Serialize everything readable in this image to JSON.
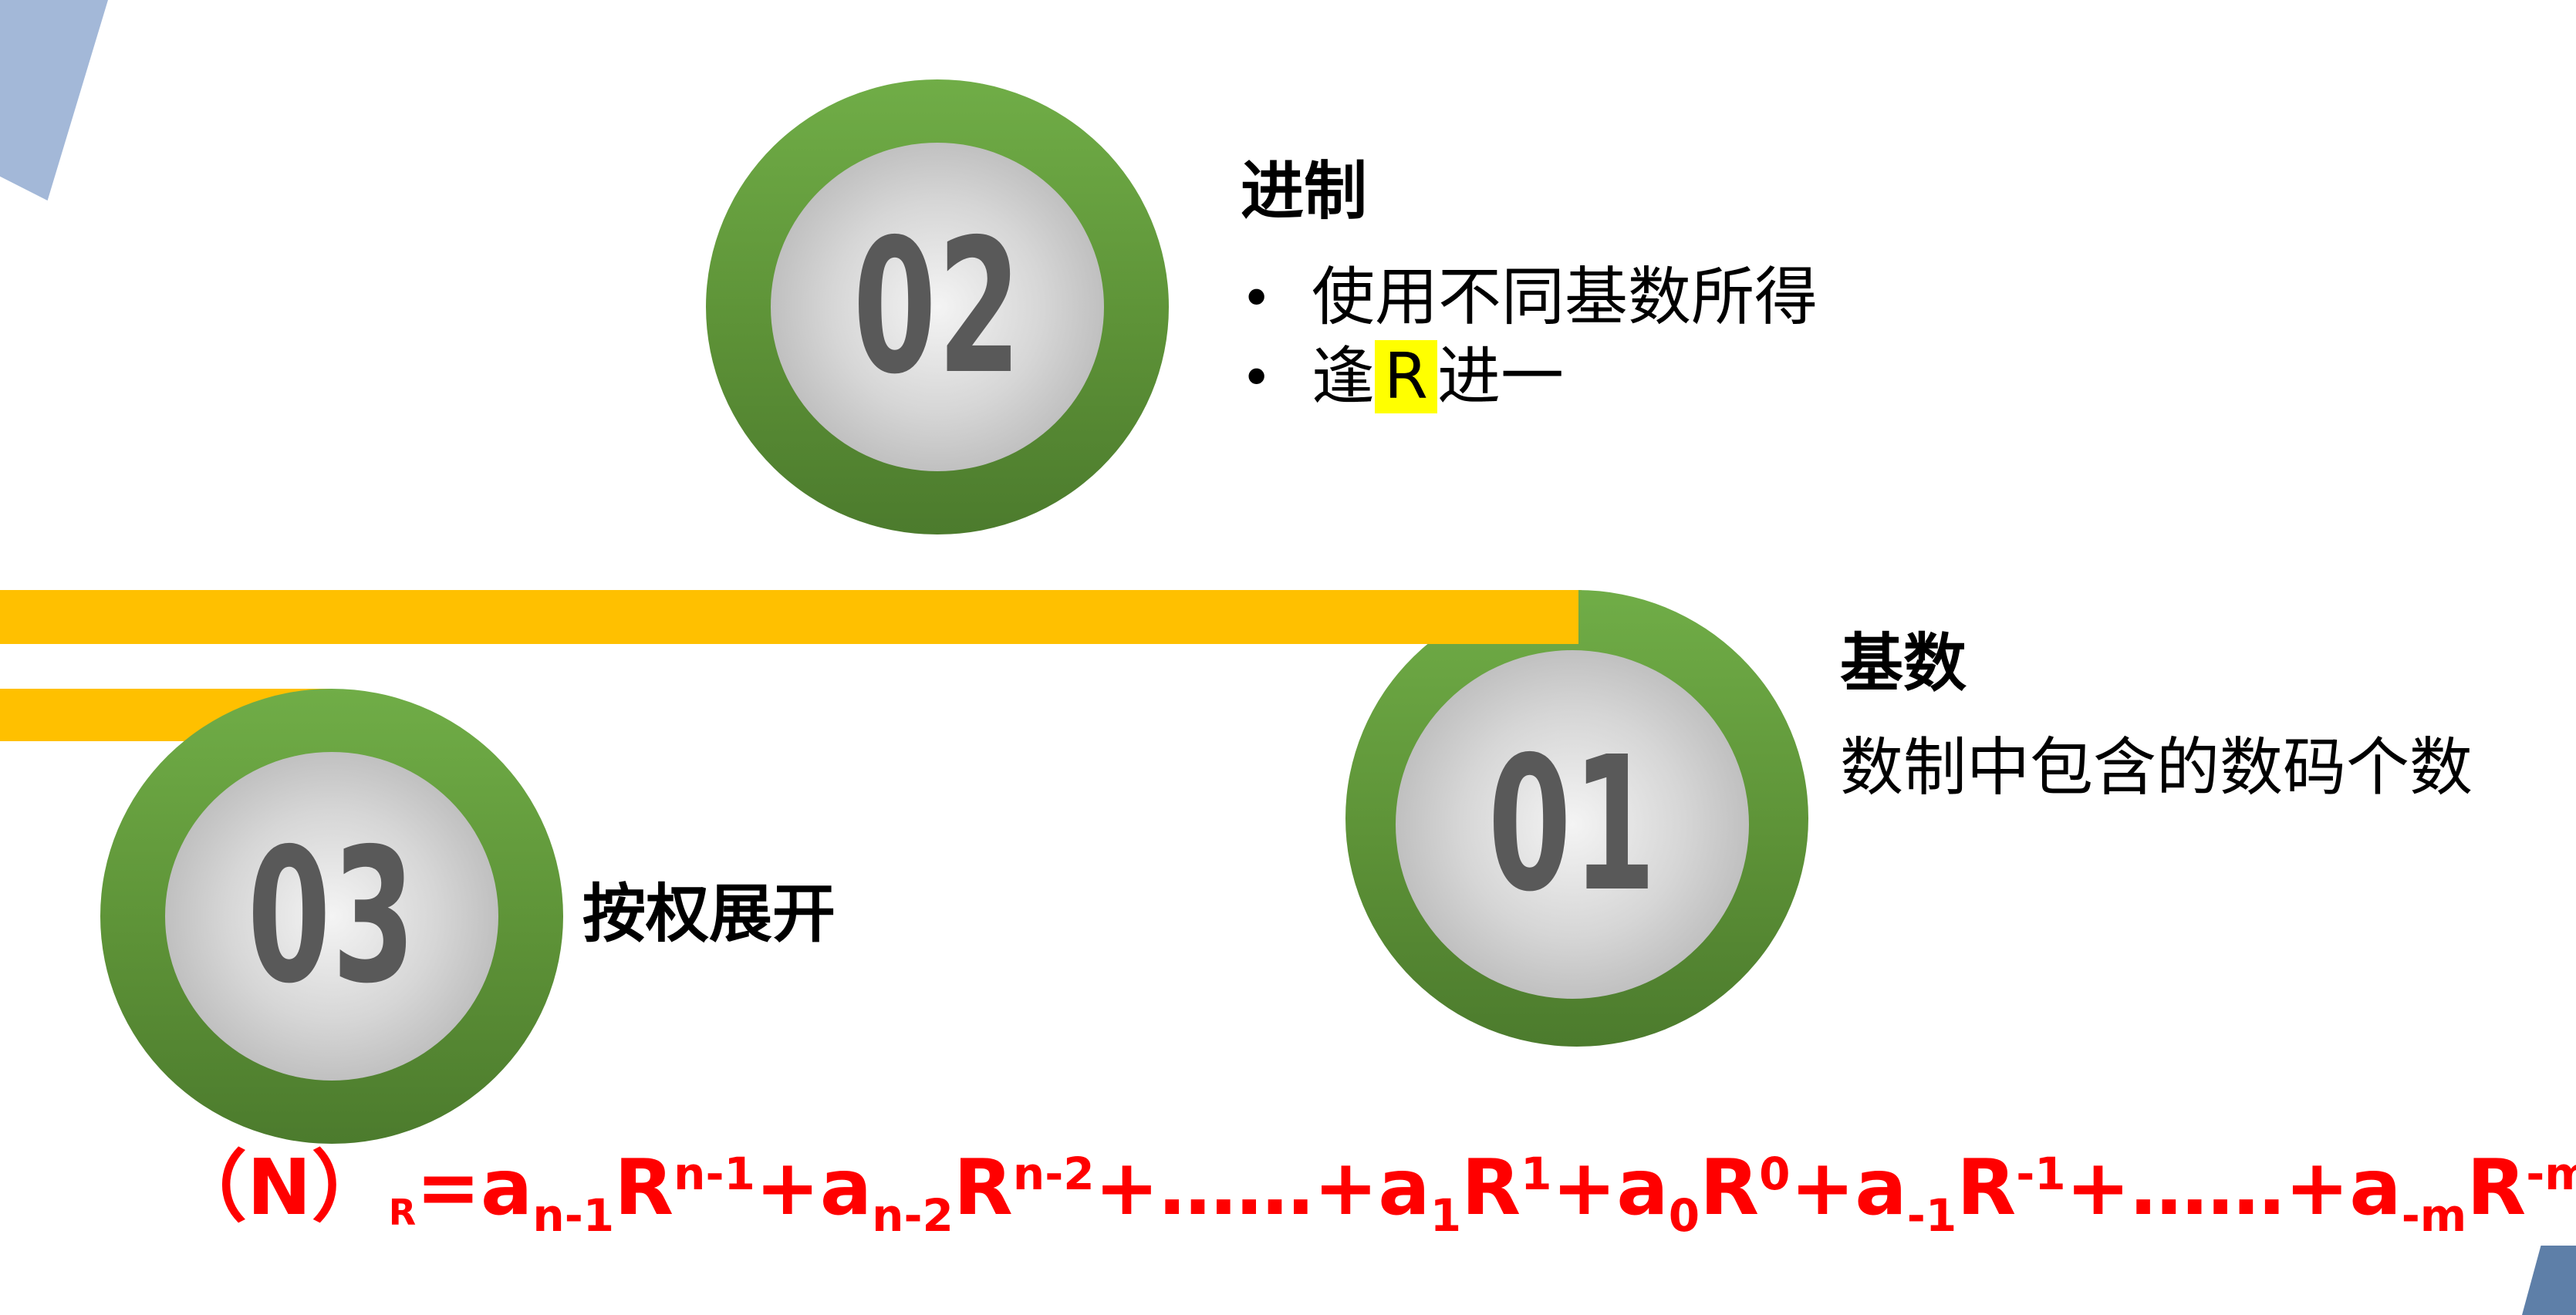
{
  "badges": {
    "b02": "02",
    "b01": "01",
    "b03": "03"
  },
  "section02": {
    "title": "进制",
    "bullets": [
      "使用不同基数所得",
      "逢",
      "R",
      "进一"
    ]
  },
  "section01": {
    "title": "基数",
    "desc": "数制中包含的数码个数"
  },
  "section03": {
    "title": "按权展开"
  },
  "formula": {
    "lhs_open": "（N）",
    "lhs_sub": "R",
    "eq": "=",
    "t1": "a",
    "t1_sub": "n-1",
    "t1_r": "R",
    "t1_sup": "n-1",
    "plus1": "+",
    "t2": "a",
    "t2_sub": "n-2",
    "t2_r": "R",
    "t2_sup": "n-2",
    "dots1": "+……+",
    "t3": "a",
    "t3_sub": "1",
    "t3_r": "R",
    "t3_sup": "1",
    "plus2": "+",
    "t4": "a",
    "t4_sub": "0",
    "t4_r": "R",
    "t4_sup": "0",
    "plus3": "+",
    "t5": "a",
    "t5_sub": "-1",
    "t5_r": "R",
    "t5_sup": "-1",
    "dots2": "+……+",
    "t6": "a",
    "t6_sub": "-m",
    "t6_r": "R",
    "t6_sup": "-m"
  },
  "colors": {
    "accent_bar": "#ffc000",
    "badge_green": "#70ad47",
    "highlight": "#ffff00",
    "formula": "#ff0000"
  }
}
